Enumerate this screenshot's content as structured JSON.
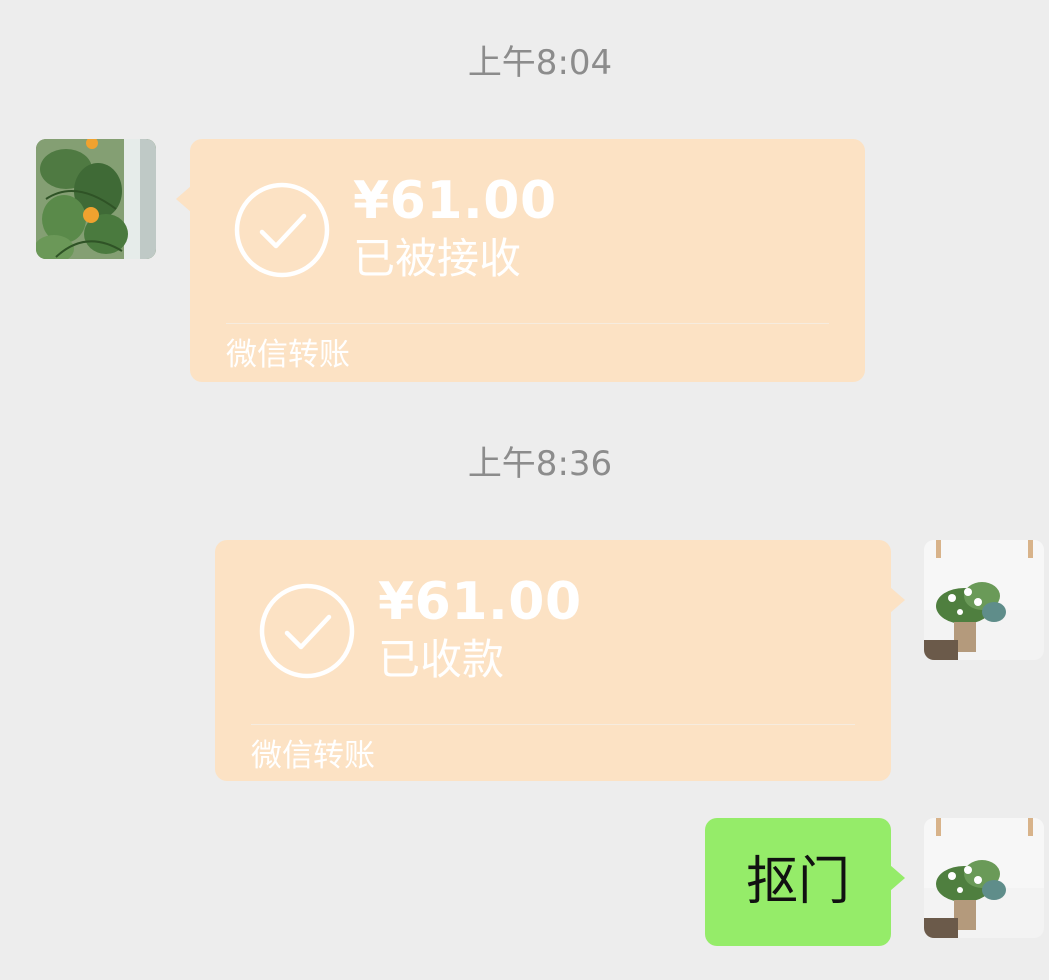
{
  "chat": {
    "timestamp_1": "上午8:04",
    "timestamp_2": "上午8:36",
    "transfer_received": {
      "amount": "¥61.00",
      "status": "已被接收",
      "footer": "微信转账"
    },
    "transfer_collected": {
      "amount": "¥61.00",
      "status": "已收款",
      "footer": "微信转账"
    },
    "text_message": "抠门"
  },
  "colors": {
    "background": "#ededed",
    "transfer_card": "#fce2c4",
    "sent_bubble": "#95ec69",
    "timestamp_text": "#8c8c8c"
  },
  "icons": {
    "transfer_status": "check-circle-icon"
  }
}
